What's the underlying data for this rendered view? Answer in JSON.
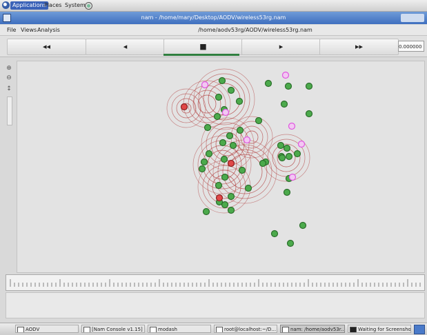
{
  "top_panel": {
    "applications": "Applications",
    "places": "Places",
    "system": "System"
  },
  "window": {
    "title": "nam - /home/mary/Desktop/AODV/wireless53rg.nam"
  },
  "menu": {
    "file": "File",
    "views": "Views",
    "analysis": "Analysis",
    "file_path": "/home/aodv53rg/AODV/wireless53rg.nam"
  },
  "playback": {
    "rewind": "◂◂",
    "back": "◂",
    "stop": "■",
    "play": "▸",
    "fast_forward": "▸▸",
    "time": "0.000000",
    "progress": 0.5
  },
  "tools": [
    "zoom-in-icon",
    "zoom-out-icon",
    "pan-icon"
  ],
  "canvas": {
    "colors": {
      "node": "#4caa4c",
      "node_border": "#2b6e2b",
      "source_node": "#e04848",
      "highlight_node": "#e055e0",
      "range_ring": "#b03a3a",
      "background": "#e3e3e3"
    },
    "nodes": [
      {
        "type": "normal"
      },
      {
        "type": "normal"
      },
      {
        "type": "normal"
      },
      {
        "type": "normal"
      },
      {
        "type": "normal"
      },
      {
        "type": "normal"
      },
      {
        "type": "normal"
      },
      {
        "type": "normal"
      },
      {
        "type": "normal"
      },
      {
        "type": "normal"
      },
      {
        "type": "normal"
      },
      {
        "type": "normal"
      },
      {
        "type": "normal"
      },
      {
        "type": "normal"
      },
      {
        "type": "normal"
      },
      {
        "type": "normal"
      },
      {
        "type": "normal"
      },
      {
        "type": "normal"
      },
      {
        "type": "normal"
      },
      {
        "type": "normal"
      },
      {
        "type": "normal"
      },
      {
        "type": "normal"
      },
      {
        "type": "normal"
      },
      {
        "type": "normal"
      },
      {
        "type": "normal"
      },
      {
        "type": "normal"
      },
      {
        "type": "normal"
      },
      {
        "type": "normal"
      },
      {
        "type": "normal"
      },
      {
        "type": "normal"
      },
      {
        "type": "normal"
      },
      {
        "type": "normal"
      },
      {
        "type": "normal"
      },
      {
        "type": "normal"
      },
      {
        "type": "normal"
      },
      {
        "type": "normal"
      },
      {
        "type": "normal"
      },
      {
        "type": "normal"
      },
      {
        "type": "normal"
      },
      {
        "type": "normal"
      },
      {
        "type": "normal"
      },
      {
        "type": "normal"
      },
      {
        "type": "normal"
      },
      {
        "type": "source"
      },
      {
        "type": "source"
      },
      {
        "type": "source"
      },
      {
        "type": "highlight"
      },
      {
        "type": "highlight"
      },
      {
        "type": "highlight"
      },
      {
        "type": "highlight"
      },
      {
        "type": "highlight"
      },
      {
        "type": "highlight"
      },
      {
        "type": "highlight"
      }
    ]
  },
  "taskbar": {
    "items": [
      "AODV",
      "[Nam Console v1.15]",
      "modash",
      "root@localhost:~/D...",
      "nam: /home/aodv53r...",
      "Waiting for Screenshot"
    ]
  }
}
